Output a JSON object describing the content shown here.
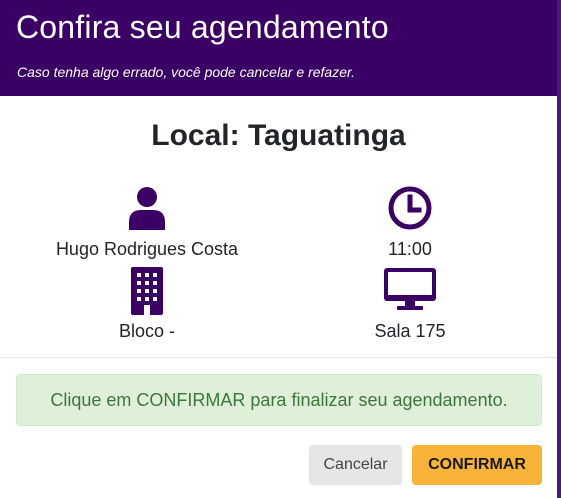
{
  "modal": {
    "title": "Confira seu agendamento",
    "subtitle": "Caso tenha algo errado, você pode cancelar e refazer."
  },
  "location": {
    "title": "Local: Taguatinga"
  },
  "details": {
    "person": {
      "icon": "user-icon",
      "value": "Hugo Rodrigues Costa"
    },
    "time": {
      "icon": "clock-icon",
      "value": "11:00"
    },
    "block": {
      "icon": "building-icon",
      "value": "Bloco -"
    },
    "room": {
      "icon": "desktop-icon",
      "value": "Sala 175"
    }
  },
  "alert": {
    "message": "Clique em CONFIRMAR para finalizar seu agendamento."
  },
  "buttons": {
    "cancel_label": "Cancelar",
    "confirm_label": "CONFIRMAR"
  },
  "colors": {
    "header_bg": "#3b0066",
    "icon": "#3b0066",
    "alert_bg": "#dff0d8",
    "alert_text": "#3c763d",
    "confirm_bg": "#f9b338",
    "cancel_bg": "#e6e6e6"
  }
}
